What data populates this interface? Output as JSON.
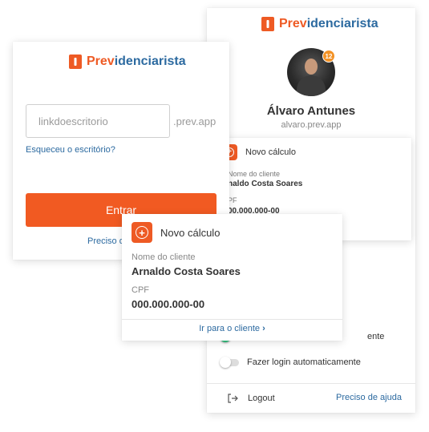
{
  "brand": {
    "prefix": "Prev",
    "rest": "idenciarista",
    "orange": "#ee5a24",
    "blue": "#2c6aa0"
  },
  "profile": {
    "name": "Álvaro Antunes",
    "site": "alvaro.prev.app",
    "notification_count": "12"
  },
  "calc_back": {
    "title": "Novo cálculo",
    "client_label": "Nome do cliente",
    "client_value": "naldo Costa Soares",
    "cpf_label": "PF",
    "cpf_value": "00.000.000-00"
  },
  "settings": {
    "toggle1_label_fragment": "ente",
    "toggle2_label": "Fazer login automaticamente"
  },
  "footer": {
    "logout_label": "Logout",
    "help_label": "Preciso de ajuda"
  },
  "login": {
    "placeholder": "linkdoescritorio",
    "suffix": ".prev.app",
    "forgot_label": "Esqueceu o escritório?",
    "enter_label": "Entrar",
    "help_fragment": "Preciso d"
  },
  "calc_front": {
    "title": "Novo cálculo",
    "client_label": "Nome do cliente",
    "client_value": "Arnaldo Costa Soares",
    "cpf_label": "CPF",
    "cpf_value": "000.000.000-00",
    "link_label": "Ir para o cliente"
  }
}
